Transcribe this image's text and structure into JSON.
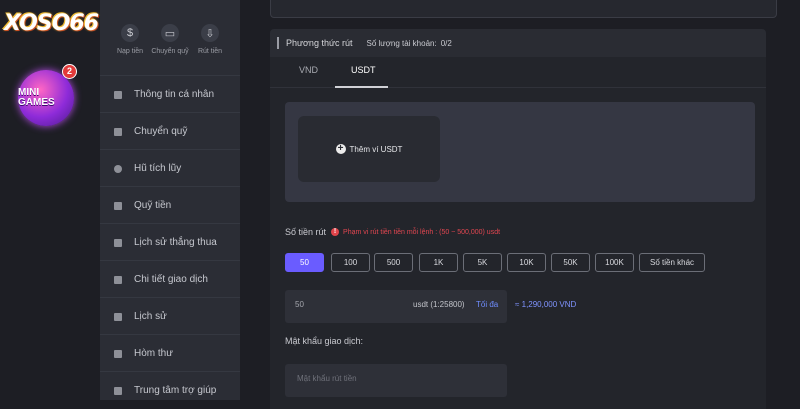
{
  "brand": {
    "logo_text": "XOSO66",
    "game_badge_label": "MINI GAMES",
    "game_badge_count": "2"
  },
  "quick_actions": [
    {
      "label": "Nạp tiền",
      "icon": "deposit-icon"
    },
    {
      "label": "Chuyển quỹ",
      "icon": "wallet-icon"
    },
    {
      "label": "Rút tiền",
      "icon": "withdraw-icon"
    }
  ],
  "menu": [
    {
      "label": "Thông tin cá nhân",
      "icon": "user-icon"
    },
    {
      "label": "Chuyển quỹ",
      "icon": "transfer-icon"
    },
    {
      "label": "Hũ tích lũy",
      "icon": "jar-icon"
    },
    {
      "label": "Quỹ tiền",
      "icon": "fund-icon"
    },
    {
      "label": "Lịch sử thắng thua",
      "icon": "history-win-icon"
    },
    {
      "label": "Chi tiết giao dịch",
      "icon": "transaction-icon"
    },
    {
      "label": "Lịch sử",
      "icon": "history-icon"
    },
    {
      "label": "Hòm thư",
      "icon": "mail-icon"
    },
    {
      "label": "Trung tâm trợ giúp",
      "icon": "help-icon"
    }
  ],
  "withdraw": {
    "title": "Phương thức rút",
    "account_count_label": "Số lượng tài khoản:",
    "account_count": "0/2",
    "tabs": [
      "VND",
      "USDT"
    ],
    "active_tab": "USDT",
    "add_wallet_label": "Thêm ví USDT",
    "amount_label": "Số tiền rút",
    "range_warning": "Phạm vi rút tiền tiền mỗi lệnh : (50 ~ 500,000) usdt",
    "chips": [
      "50",
      "100",
      "500",
      "1K",
      "5K",
      "10K",
      "50K",
      "100K",
      "Số tiền khác"
    ],
    "active_chip": "50",
    "amount_value": "50",
    "amount_unit": "usdt (1:25800)",
    "max_label": "Tối đa",
    "converted": "≈ 1,290,000 VND",
    "password_label": "Mật khẩu giao dịch:",
    "password_placeholder": "Mật khẩu rút tiền"
  },
  "colors": {
    "accent": "#6a5cff",
    "warning": "#e14650",
    "link": "#6f8dff"
  }
}
